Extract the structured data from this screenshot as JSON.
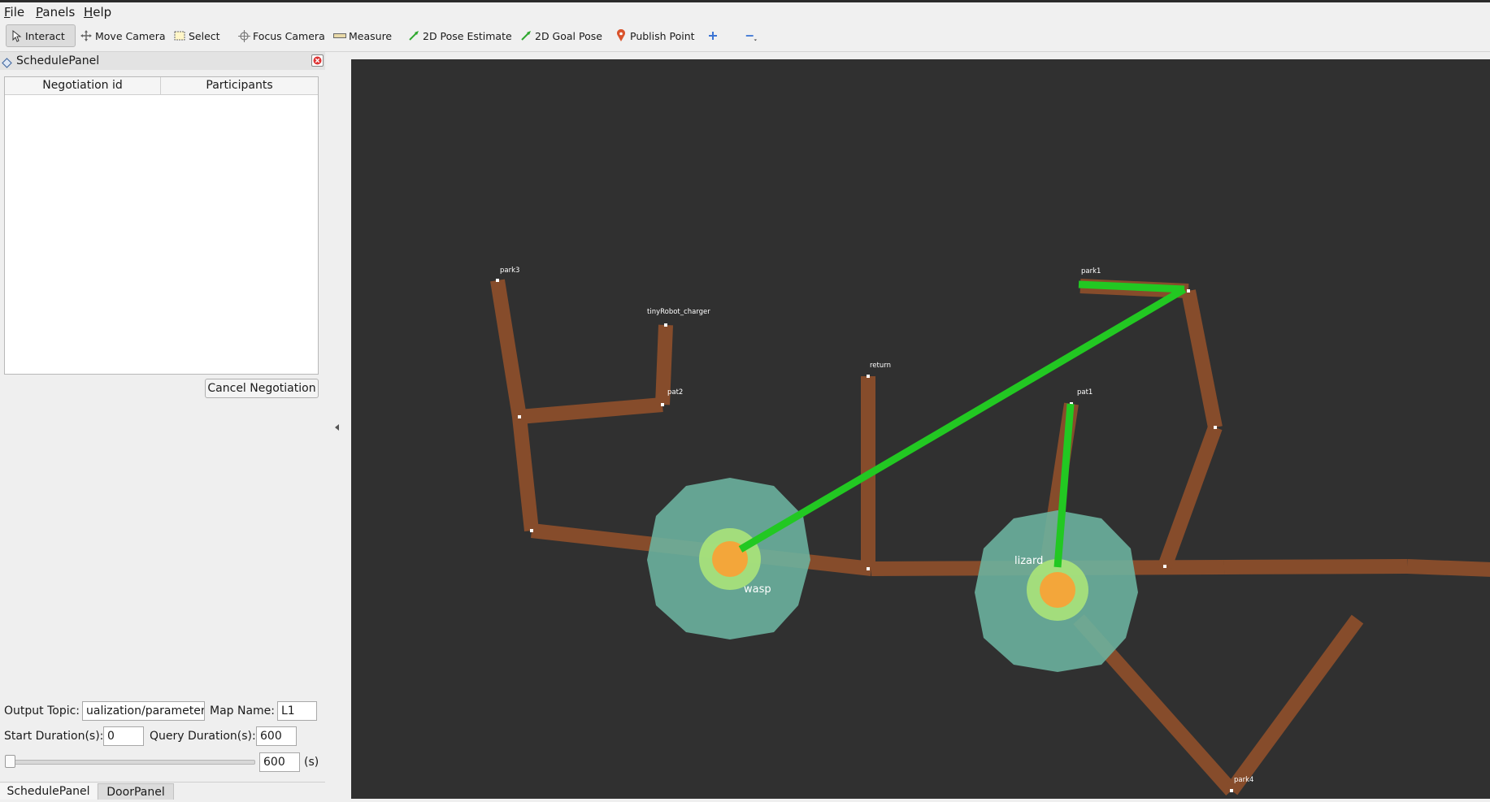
{
  "menubar": {
    "items": [
      "File",
      "Panels",
      "Help"
    ]
  },
  "toolbar": {
    "tools": [
      {
        "label": "Interact",
        "icon": "cursor-icon",
        "active": true
      },
      {
        "label": "Move Camera",
        "icon": "move-icon"
      },
      {
        "label": "Select",
        "icon": "select-box-icon"
      },
      {
        "label": "Focus Camera",
        "icon": "crosshair-icon"
      },
      {
        "label": "Measure",
        "icon": "ruler-icon"
      },
      {
        "label": "2D Pose Estimate",
        "icon": "green-arrow-icon"
      },
      {
        "label": "2D Goal Pose",
        "icon": "green-arrow-icon"
      },
      {
        "label": "Publish Point",
        "icon": "map-pin-icon"
      }
    ],
    "add_icon": "plus-icon",
    "remove_icon": "minus-icon"
  },
  "schedule_panel": {
    "title": "SchedulePanel",
    "columns": [
      "Negotiation id",
      "Participants"
    ],
    "rows": [],
    "cancel_button": "Cancel Negotiation",
    "output_topic_label": "Output Topic:",
    "output_topic_value": "ualization/parameters",
    "map_name_label": "Map Name:",
    "map_name_value": "L1",
    "start_duration_label": "Start Duration(s):",
    "start_duration_value": "0",
    "query_duration_label": "Query Duration(s):",
    "query_duration_value": "600",
    "slider_value": "600",
    "slider_unit": "(s)",
    "slider_level": 0
  },
  "bottom_tabs": [
    {
      "label": "SchedulePanel",
      "active": true
    },
    {
      "label": "DoorPanel",
      "active": false
    }
  ],
  "viewport": {
    "background": "#303030",
    "lane_color": "#8b4e2b",
    "path_color": "#22c822",
    "robot_footprint_color": "#6cb4a0",
    "robot_core_color": "#f3a63a",
    "waypoints": [
      "park3",
      "tinyRobot_charger",
      "pat2",
      "return",
      "park1",
      "pat1",
      "park4"
    ],
    "robots": [
      "wasp",
      "lizard"
    ]
  }
}
